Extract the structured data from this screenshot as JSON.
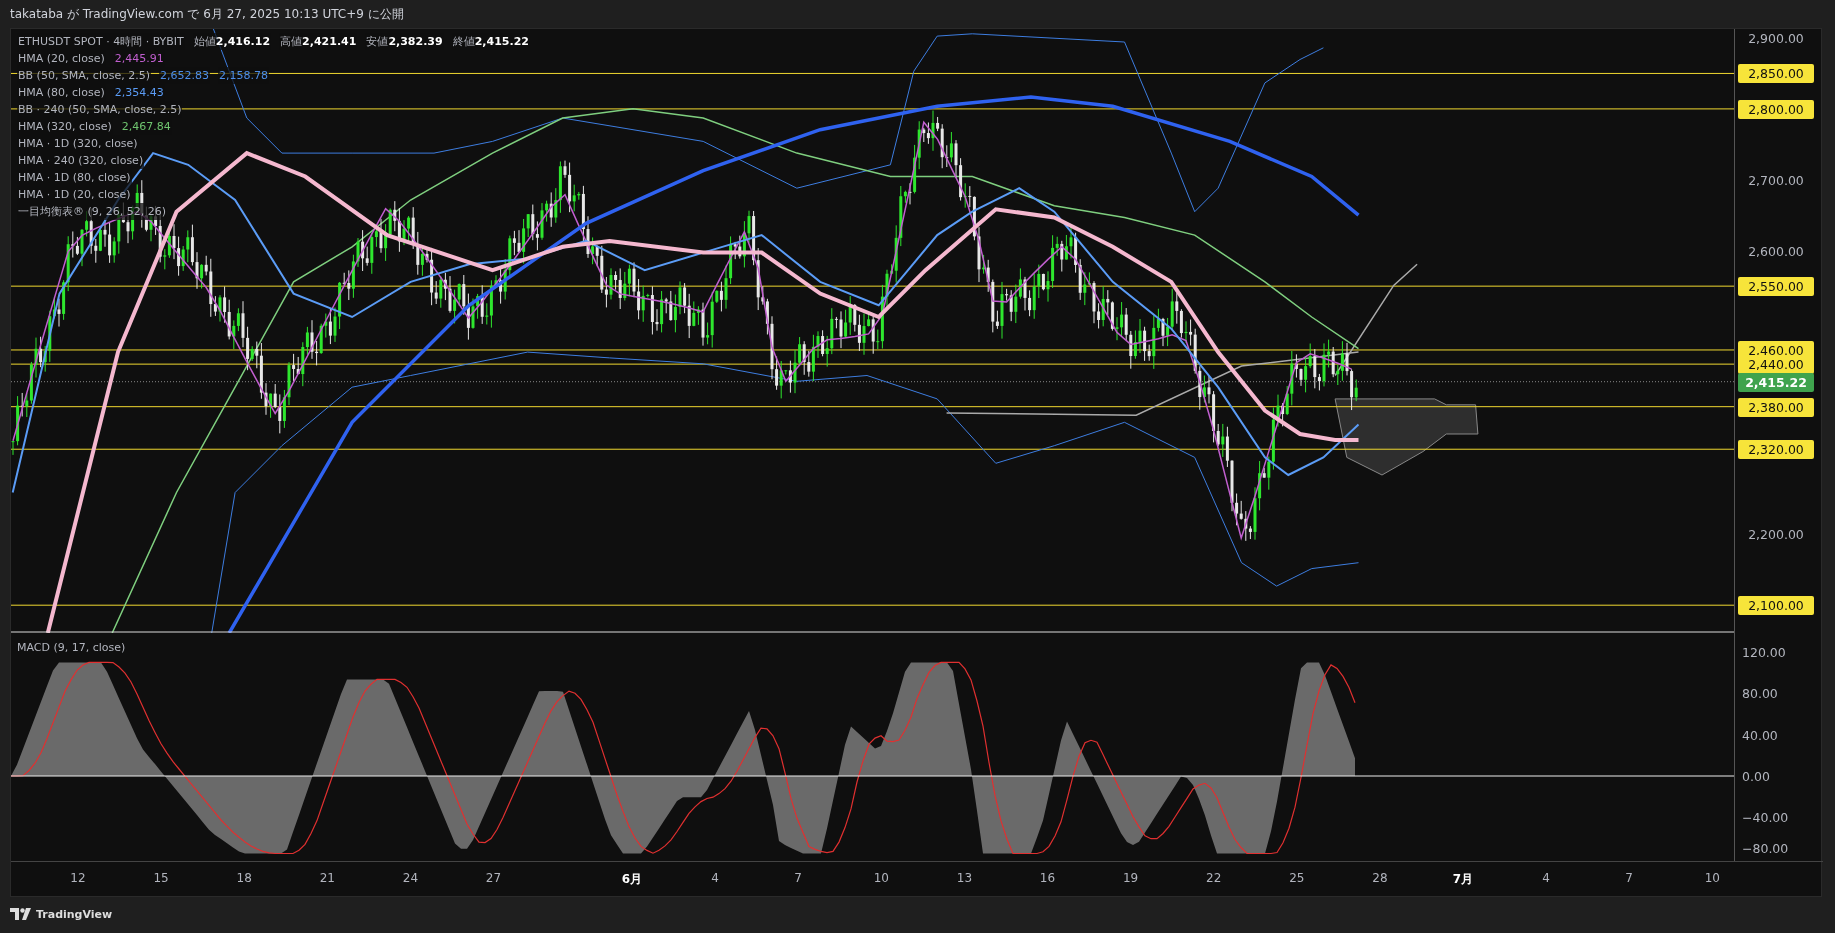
{
  "header": {
    "text": "takataba が TradingView.com で 6月 27, 2025 10:13 UTC+9 に公開"
  },
  "legend": {
    "symbol": "ETHUSDT SPOT · 4時間 · BYBIT",
    "ohlc": [
      {
        "label": "始値",
        "value": "2,416.12"
      },
      {
        "label": "高値",
        "value": "2,421.41"
      },
      {
        "label": "安値",
        "value": "2,382.39"
      },
      {
        "label": "終値",
        "value": "2,415.22"
      }
    ],
    "indicators": [
      {
        "name": "HMA (20, close)",
        "values": [
          {
            "text": "2,445.91",
            "color": "#c15fcf"
          }
        ]
      },
      {
        "name": "BB (50, SMA, close, 2.5)",
        "values": [
          {
            "text": "2,652.83",
            "color": "#4e8fe8"
          },
          {
            "text": "2,158.78",
            "color": "#4e8fe8"
          }
        ]
      },
      {
        "name": "HMA (80, close)",
        "values": [
          {
            "text": "2,354.43",
            "color": "#5b9cf6"
          }
        ]
      },
      {
        "name": "BB · 240 (50, SMA, close, 2.5)"
      },
      {
        "name": "HMA (320, close)",
        "values": [
          {
            "text": "2,467.84",
            "color": "#6fc46f"
          }
        ]
      },
      {
        "name": "HMA · 1D (320, close)"
      },
      {
        "name": "HMA · 240 (320, close)"
      },
      {
        "name": "HMA · 1D (80, close)"
      },
      {
        "name": "HMA · 1D (20, close)"
      },
      {
        "name": "一目均衡表® (9, 26, 52, 26)"
      }
    ]
  },
  "price_axis": {
    "labels": [
      {
        "text": "2,900.00",
        "kind": "tick"
      },
      {
        "text": "2,850.00",
        "kind": "level"
      },
      {
        "text": "2,800.00",
        "kind": "level"
      },
      {
        "text": "2,700.00",
        "kind": "tick"
      },
      {
        "text": "2,600.00",
        "kind": "tick"
      },
      {
        "text": "2,550.00",
        "kind": "level"
      },
      {
        "text": "2,460.00",
        "kind": "level"
      },
      {
        "text": "2,440.00",
        "kind": "level"
      },
      {
        "text": "2,415.22",
        "kind": "last"
      },
      {
        "text": "2,380.00",
        "kind": "level"
      },
      {
        "text": "2,320.00",
        "kind": "level"
      },
      {
        "text": "2,200.00",
        "kind": "tick"
      },
      {
        "text": "2,100.00",
        "kind": "level"
      }
    ]
  },
  "macd": {
    "label": "MACD (9, 17, close)",
    "axis": [
      "120.00",
      "80.00",
      "40.00",
      "0.00",
      "−40.00",
      "−80.00"
    ]
  },
  "time_axis": {
    "labels": [
      {
        "text": "12",
        "kind": "day"
      },
      {
        "text": "15",
        "kind": "day"
      },
      {
        "text": "18",
        "kind": "day"
      },
      {
        "text": "21",
        "kind": "day"
      },
      {
        "text": "24",
        "kind": "day"
      },
      {
        "text": "27",
        "kind": "day"
      },
      {
        "text": "6月",
        "kind": "month"
      },
      {
        "text": "4",
        "kind": "day"
      },
      {
        "text": "7",
        "kind": "day"
      },
      {
        "text": "10",
        "kind": "day"
      },
      {
        "text": "13",
        "kind": "day"
      },
      {
        "text": "16",
        "kind": "day"
      },
      {
        "text": "19",
        "kind": "day"
      },
      {
        "text": "22",
        "kind": "day"
      },
      {
        "text": "25",
        "kind": "day"
      },
      {
        "text": "28",
        "kind": "day"
      },
      {
        "text": "7月",
        "kind": "month"
      },
      {
        "text": "4",
        "kind": "day"
      },
      {
        "text": "7",
        "kind": "day"
      },
      {
        "text": "10",
        "kind": "day"
      }
    ]
  },
  "footer": {
    "brand": "TradingView"
  }
}
